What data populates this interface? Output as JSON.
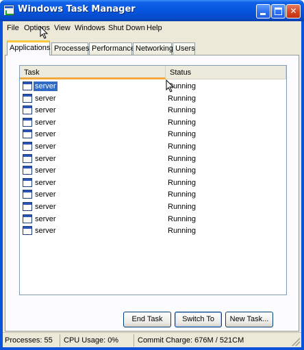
{
  "window": {
    "title": "Windows Task Manager"
  },
  "icons": {
    "app": "task-manager-icon",
    "minimize": "minimize-icon",
    "maximize": "maximize-icon",
    "close": "close-icon",
    "row": "application-window-icon",
    "pointer": "mouse-pointer-icon"
  },
  "title_buttons": {
    "close_glyph": "✕"
  },
  "menu": [
    "File",
    "Options",
    "View",
    "Windows",
    "Shut Down",
    "Help"
  ],
  "tabs": [
    "Applications",
    "Processes",
    "Performance",
    "Networking",
    "Users"
  ],
  "active_tab": "Applications",
  "list": {
    "columns": {
      "task": "Task",
      "status": "Status"
    },
    "rows": [
      {
        "task": "server",
        "status": "Running",
        "selected": true
      },
      {
        "task": "server",
        "status": "Running"
      },
      {
        "task": "server",
        "status": "Running"
      },
      {
        "task": "server",
        "status": "Running"
      },
      {
        "task": "server",
        "status": "Running"
      },
      {
        "task": "server",
        "status": "Running"
      },
      {
        "task": "server",
        "status": "Running"
      },
      {
        "task": "server",
        "status": "Running"
      },
      {
        "task": "server",
        "status": "Running"
      },
      {
        "task": "server",
        "status": "Running"
      },
      {
        "task": "server",
        "status": "Running"
      },
      {
        "task": "server",
        "status": "Running"
      },
      {
        "task": "server",
        "status": "Running"
      }
    ]
  },
  "buttons": {
    "end_task": "End Task",
    "switch_to": "Switch To",
    "new_task": "New Task..."
  },
  "statusbar": {
    "processes": "Processes: 55",
    "cpu": "CPU Usage: 0%",
    "commit": "Commit Charge: 676M / 521CM"
  },
  "colors": {
    "title_blue": "#0654dc",
    "selection": "#316ac5",
    "tab_highlight": "#ffc83c",
    "close_red": "#d4411d"
  }
}
